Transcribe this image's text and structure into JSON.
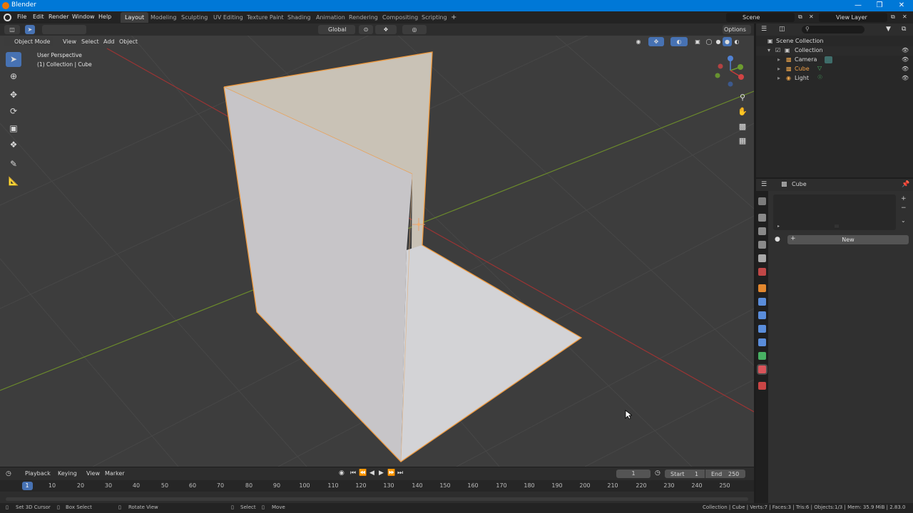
{
  "window": {
    "title": "Blender"
  },
  "menu": [
    "File",
    "Edit",
    "Render",
    "Window",
    "Help"
  ],
  "workspaces": [
    "Layout",
    "Modeling",
    "Sculpting",
    "UV Editing",
    "Texture Paint",
    "Shading",
    "Animation",
    "Rendering",
    "Compositing",
    "Scripting"
  ],
  "active_workspace": "Layout",
  "scene": {
    "name": "Scene",
    "view_layer": "View Layer"
  },
  "viewport": {
    "orientation": "Global",
    "options_label": "Options",
    "mode": "Object Mode",
    "menus": [
      "View",
      "Select",
      "Add",
      "Object"
    ],
    "overlay_line1": "User Perspective",
    "overlay_line2": "(1) Collection | Cube"
  },
  "outliner": {
    "root": "Scene Collection",
    "collection": "Collection",
    "items": [
      "Camera",
      "Cube",
      "Light"
    ]
  },
  "properties": {
    "object_name": "Cube",
    "new_button": "New"
  },
  "timeline": {
    "menus": [
      "Playback",
      "Keying",
      "View",
      "Marker"
    ],
    "current_frame": "1",
    "start_label": "Start",
    "start_value": "1",
    "end_label": "End",
    "end_value": "250",
    "ticks": [
      "1",
      "10",
      "20",
      "30",
      "40",
      "50",
      "60",
      "70",
      "80",
      "90",
      "100",
      "110",
      "120",
      "130",
      "140",
      "150",
      "160",
      "170",
      "180",
      "190",
      "200",
      "210",
      "220",
      "230",
      "240",
      "250"
    ]
  },
  "statusbar": {
    "hint1": "Set 3D Cursor",
    "hint2": "Box Select",
    "hint3": "Rotate View",
    "hint4": "Select",
    "hint5": "Move",
    "info": "Collection | Cube | Verts:7 | Faces:3 | Tris:6 | Objects:1/3 | Mem: 35.9 MiB | 2.83.0"
  }
}
